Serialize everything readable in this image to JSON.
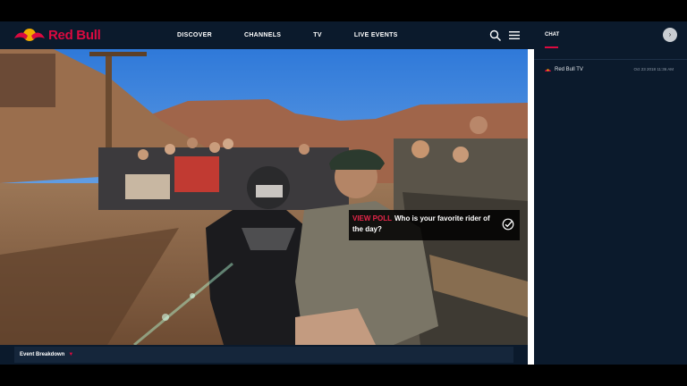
{
  "brand": {
    "name": "Red Bull",
    "colors": {
      "red": "#db0a40",
      "yellow": "#f0ab00",
      "navy": "#0b1a2c"
    }
  },
  "nav": {
    "links": [
      {
        "id": "discover",
        "label": "DISCOVER"
      },
      {
        "id": "channels",
        "label": "CHANNELS"
      },
      {
        "id": "tv",
        "label": "TV"
      },
      {
        "id": "live-events",
        "label": "LIVE EVENTS"
      }
    ],
    "icons": {
      "search": "search-icon",
      "menu": "hamburger-menu-icon"
    }
  },
  "video": {
    "poll": {
      "label": "VIEW POLL",
      "question": "Who is your favorite rider of the day?",
      "icon": "check-circle-icon"
    },
    "breakdown": {
      "label": "Event Breakdown",
      "icon": "caret-down-icon"
    }
  },
  "chat": {
    "tab_label": "CHAT",
    "collapse_icon": "chevron-right-icon",
    "messages": [
      {
        "user": "Red Bull TV",
        "timestamp": "Oct 23 2018 11:36 AM",
        "avatar_icon": "red-bull-logo-icon"
      }
    ]
  }
}
